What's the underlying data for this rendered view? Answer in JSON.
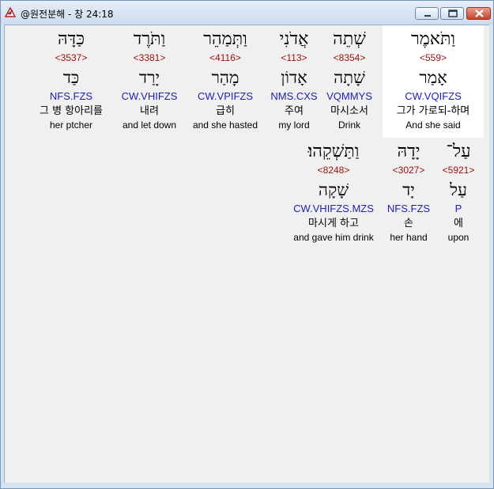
{
  "window": {
    "title": "@원전분해 - 창 24:18"
  },
  "words": [
    {
      "hebrew": "וַתֹּאמֶר",
      "strong": "<559>",
      "lemma": "אָמַר",
      "morph": "CW.VQIFZS",
      "korean": "그가 가로되-하며",
      "english": "And she said",
      "selected": true
    },
    {
      "hebrew": "שְׁתֵה",
      "strong": "<8354>",
      "lemma": "שָׁתָה",
      "morph": "VQMMYS",
      "korean": "마시소서",
      "english": "Drink",
      "selected": false
    },
    {
      "hebrew": "אֲדֹנִי",
      "strong": "<113>",
      "lemma": "אָדוֹן",
      "morph": "NMS.CXS",
      "korean": "주여",
      "english": "my lord",
      "selected": false
    },
    {
      "hebrew": "וַתְּמַהֵר",
      "strong": "<4116>",
      "lemma": "מָהַר",
      "morph": "CW.VPIFZS",
      "korean": "급히",
      "english": "and she hasted",
      "selected": false
    },
    {
      "hebrew": "וַתֹּרֶד",
      "strong": "<3381>",
      "lemma": "יָרַד",
      "morph": "CW.VHIFZS",
      "korean": "내려",
      "english": "and let down",
      "selected": false
    },
    {
      "hebrew": "כַּדָּהּ",
      "strong": "<3537>",
      "lemma": "כַּד",
      "morph": "NFS.FZS",
      "korean": "그 병 항아리를",
      "english": "her ptcher",
      "selected": false
    },
    {
      "hebrew": "עַל־",
      "strong": "<5921>",
      "lemma": "עַל",
      "morph": "P",
      "korean": "에",
      "english": "upon",
      "selected": false
    },
    {
      "hebrew": "יָדָהּ",
      "strong": "<3027>",
      "lemma": "יָד",
      "morph": "NFS.FZS",
      "korean": "손",
      "english": "her hand",
      "selected": false
    },
    {
      "hebrew": "וַתַּשְׁקֵהוּ׃",
      "strong": "<8248>",
      "lemma": "שָׁקָה",
      "morph": "CW.VHIFZS.MZS",
      "korean": "마시게 하고",
      "english": "and gave him drink",
      "selected": false
    }
  ]
}
